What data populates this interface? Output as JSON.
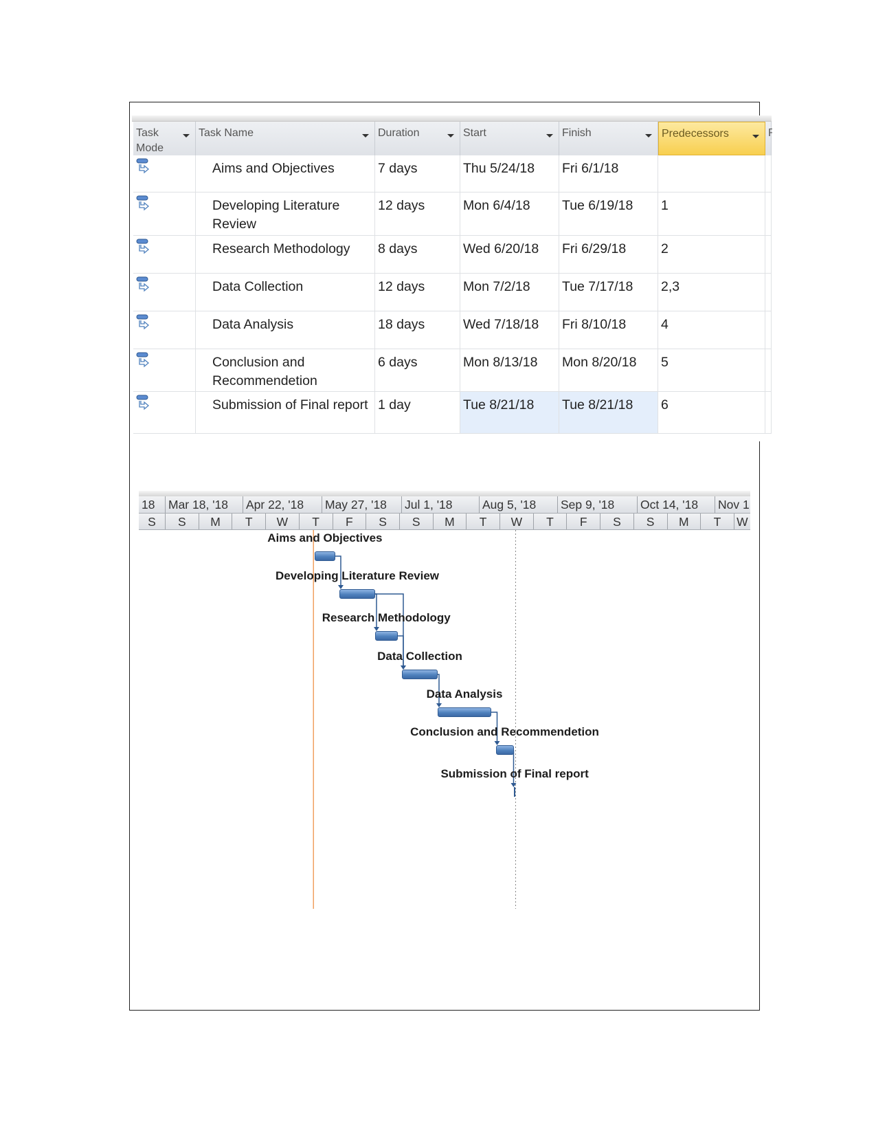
{
  "table": {
    "columns": [
      {
        "label": "Task Mode"
      },
      {
        "label": "Task Name"
      },
      {
        "label": "Duration"
      },
      {
        "label": "Start"
      },
      {
        "label": "Finish"
      },
      {
        "label": "Predecessors"
      },
      {
        "label": "R"
      }
    ],
    "rows": [
      {
        "id": 1,
        "mode_icon": "auto-scheduled-task-icon",
        "name": "Aims and Objectives",
        "duration": "7 days",
        "start": "Thu 5/24/18",
        "finish": "Fri 6/1/18",
        "predecessors": ""
      },
      {
        "id": 2,
        "mode_icon": "auto-scheduled-task-icon",
        "name": "Developing Literature Review",
        "duration": "12 days",
        "start": "Mon 6/4/18",
        "finish": "Tue 6/19/18",
        "predecessors": "1"
      },
      {
        "id": 3,
        "mode_icon": "auto-scheduled-task-icon",
        "name": "Research Methodology",
        "duration": "8 days",
        "start": "Wed 6/20/18",
        "finish": "Fri 6/29/18",
        "predecessors": "2"
      },
      {
        "id": 4,
        "mode_icon": "auto-scheduled-task-icon",
        "name": "Data Collection",
        "duration": "12 days",
        "start": "Mon 7/2/18",
        "finish": "Tue 7/17/18",
        "predecessors": "2,3"
      },
      {
        "id": 5,
        "mode_icon": "auto-scheduled-task-icon",
        "name": "Data Analysis",
        "duration": "18 days",
        "start": "Wed 7/18/18",
        "finish": "Fri 8/10/18",
        "predecessors": "4"
      },
      {
        "id": 6,
        "mode_icon": "auto-scheduled-task-icon",
        "name": "Conclusion and Recommendetion",
        "duration": "6 days",
        "start": "Mon 8/13/18",
        "finish": "Mon 8/20/18",
        "predecessors": "5"
      },
      {
        "id": 7,
        "mode_icon": "auto-scheduled-task-icon",
        "name": "Submission of Final report",
        "duration": "1 day",
        "start": "Tue 8/21/18",
        "finish": "Tue 8/21/18",
        "predecessors": "6"
      }
    ],
    "highlight_color": "#f8cf4f"
  },
  "gantt": {
    "timescale_top": [
      "18",
      "Mar 18, '18",
      "Apr 22, '18",
      "May 27, '18",
      "Jul 1, '18",
      "Aug 5, '18",
      "Sep 9, '18",
      "Oct 14, '18",
      "Nov 1"
    ],
    "timescale_bottom": [
      "S",
      "S",
      "M",
      "T",
      "W",
      "T",
      "F",
      "S",
      "S",
      "M",
      "T",
      "W",
      "T",
      "F",
      "S",
      "S",
      "M",
      "T",
      "W"
    ],
    "bars": [
      {
        "label": "Aims and Objectives",
        "start": "2018-05-24",
        "finish": "2018-06-01"
      },
      {
        "label": "Developing Literature Review",
        "start": "2018-06-04",
        "finish": "2018-06-19"
      },
      {
        "label": "Research Methodology",
        "start": "2018-06-20",
        "finish": "2018-06-29"
      },
      {
        "label": "Data Collection",
        "start": "2018-07-02",
        "finish": "2018-07-17"
      },
      {
        "label": "Data Analysis",
        "start": "2018-07-18",
        "finish": "2018-08-10"
      },
      {
        "label": "Conclusion and Recommendetion",
        "start": "2018-08-13",
        "finish": "2018-08-20"
      },
      {
        "label": "Submission of Final report",
        "start": "2018-08-21",
        "finish": "2018-08-21",
        "milestone": true
      }
    ],
    "project_start_line": "2018-05-24",
    "current_date_line": "2018-08-21",
    "bar_color": "#4f81bd",
    "start_line_color": "#f0a060"
  }
}
